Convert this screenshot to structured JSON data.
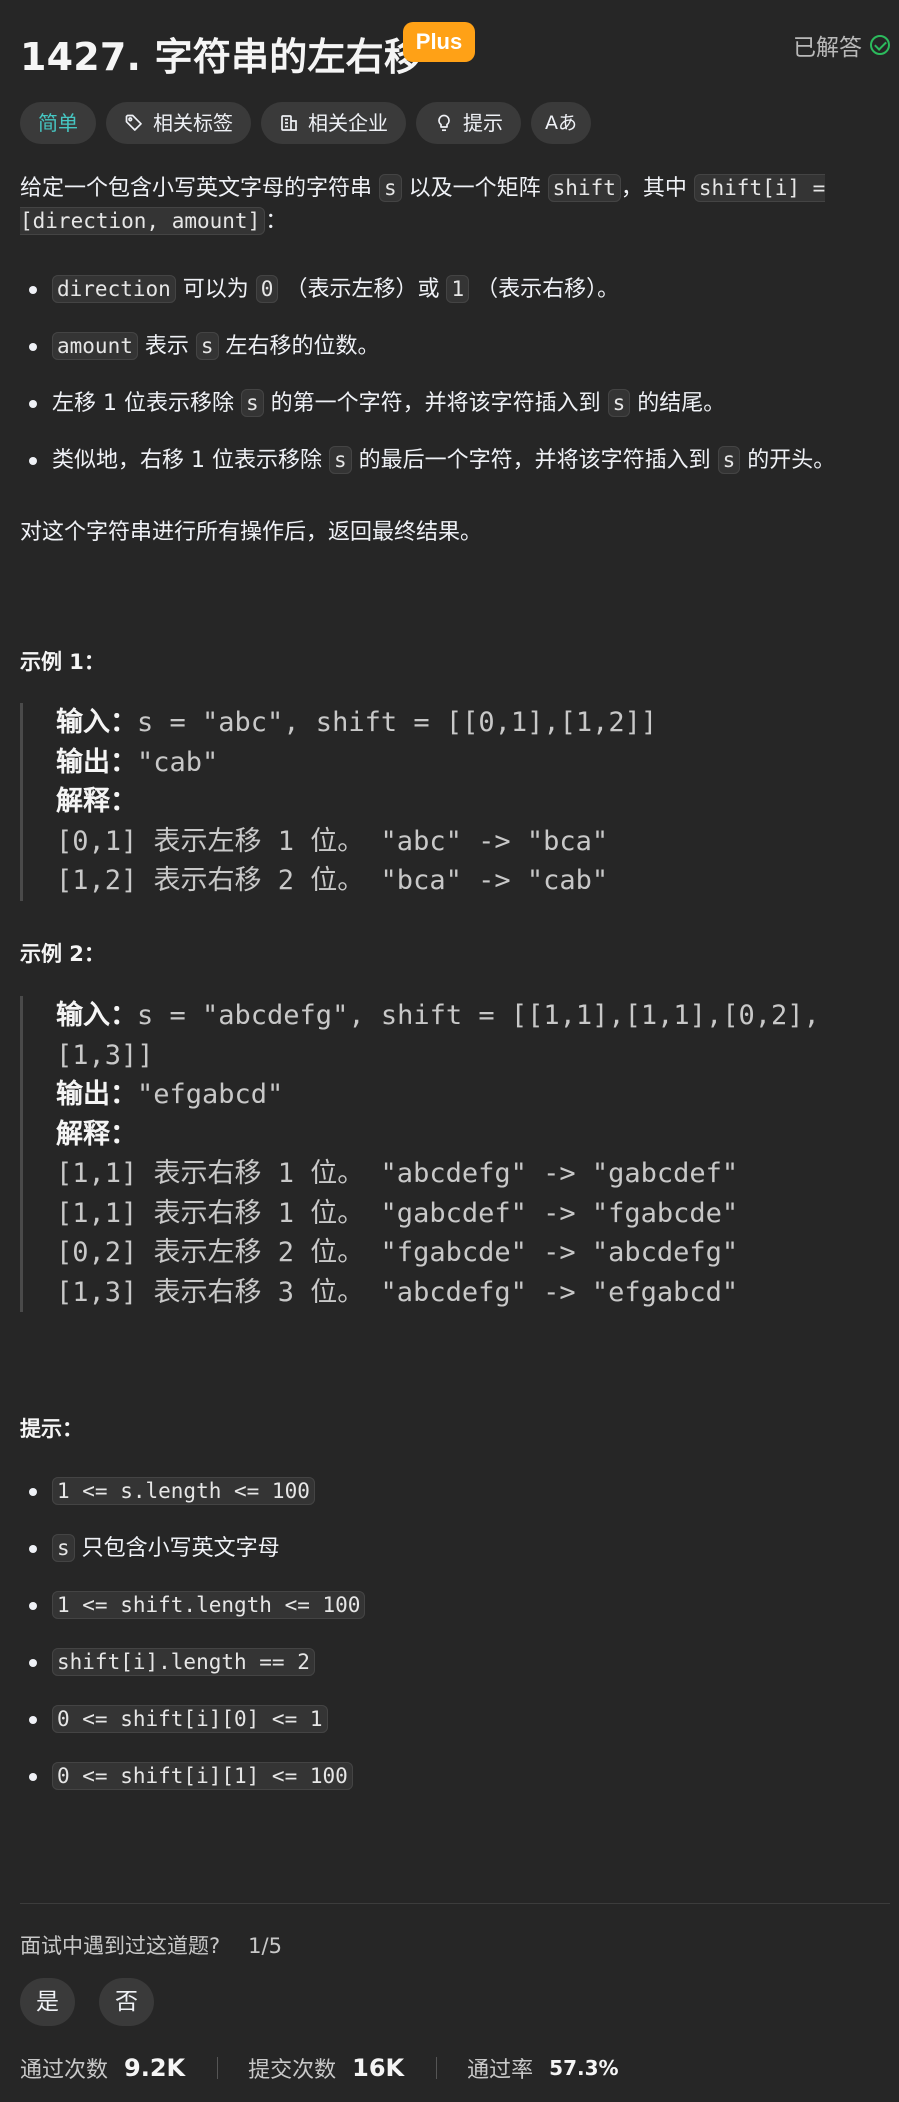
{
  "problem": {
    "title": "1427. 字符串的左右移",
    "badge": "Plus",
    "status": "已解答"
  },
  "tags": {
    "difficulty": "简单",
    "related_tags": "相关标签",
    "related_companies": "相关企业",
    "hint": "提示",
    "translate_icon": "Aあ"
  },
  "description": {
    "p1_a": "给定一个包含小写英文字母的字符串 ",
    "p1_code1": "s",
    "p1_b": " 以及一个矩阵 ",
    "p1_code2": "shift",
    "p1_c": "，其中 ",
    "p1_code3": "shift[i] = [direction, amount]",
    "p1_d": "：",
    "bullets": [
      {
        "code1": "direction",
        "t1": " 可以为 ",
        "code2": "0",
        "t2": " （表示左移）或 ",
        "code3": "1",
        "t3": " （表示右移）。"
      },
      {
        "code1": "amount",
        "t1": " 表示 ",
        "code2": "s",
        "t2": " 左右移的位数。"
      },
      {
        "t0": "左移 1 位表示移除 ",
        "code1": "s",
        "t1": " 的第一个字符，并将该字符插入到 ",
        "code2": "s",
        "t2": " 的结尾。"
      },
      {
        "t0": "类似地，右移 1 位表示移除 ",
        "code1": "s",
        "t1": " 的最后一个字符，并将该字符插入到 ",
        "code2": "s",
        "t2": " 的开头。"
      }
    ],
    "closing": "对这个字符串进行所有操作后，返回最终结果。"
  },
  "example1": {
    "heading": "示例 1：",
    "input_label": "输入：",
    "input": "s = \"abc\", shift = [[0,1],[1,2]]",
    "output_label": "输出：",
    "output": "\"cab\"",
    "explain_label": "解释：",
    "lines": [
      "[0,1] 表示左移 1 位。 \"abc\" -> \"bca\"",
      "[1,2] 表示右移 2 位。 \"bca\" -> \"cab\""
    ]
  },
  "example2": {
    "heading": "示例 2：",
    "input_label": "输入：",
    "input_line1": "s = \"abcdefg\", shift = [[1,1],[1,1],[0,2],",
    "input_line2": "[1,3]]",
    "output_label": "输出：",
    "output": "\"efgabcd\"",
    "explain_label": "解释：",
    "lines": [
      "[1,1] 表示右移 1 位。 \"abcdefg\" -> \"gabcdef\"",
      "[1,1] 表示右移 1 位。 \"gabcdef\" -> \"fgabcde\"",
      "[0,2] 表示左移 2 位。 \"fgabcde\" -> \"abcdefg\"",
      "[1,3] 表示右移 3 位。 \"abcdefg\" -> \"efgabcd\""
    ]
  },
  "constraints": {
    "heading": "提示：",
    "items": [
      {
        "code": "1 <= s.length <= 100",
        "text": ""
      },
      {
        "code": "s",
        "text": " 只包含小写英文字母"
      },
      {
        "code": "1 <= shift.length <= 100",
        "text": ""
      },
      {
        "code": "shift[i].length == 2",
        "text": ""
      },
      {
        "code": "0 <= shift[i][0] <= 1",
        "text": ""
      },
      {
        "code": "0 <= shift[i][1] <= 100",
        "text": ""
      }
    ]
  },
  "interview": {
    "question": "面试中遇到过这道题?",
    "count": "1/5",
    "yes": "是",
    "no": "否"
  },
  "stats": {
    "accepted_label": "通过次数",
    "accepted_value": "9.2K",
    "submissions_label": "提交次数",
    "submissions_value": "16K",
    "rate_label": "通过率",
    "rate_value": "57.3%"
  }
}
